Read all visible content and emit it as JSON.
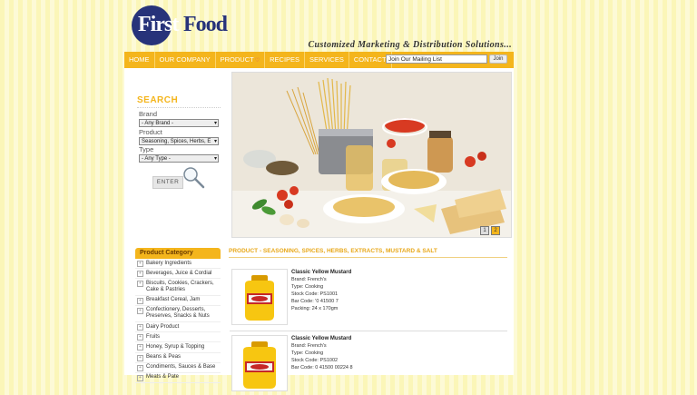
{
  "header": {
    "logo_first": "First",
    "logo_food": "Food",
    "tagline": "Customized Marketing & Distribution Solutions..."
  },
  "nav": {
    "items": [
      "HOME",
      "OUR COMPANY",
      "PRODUCT",
      "RECIPES",
      "SERVICES",
      "CONTACT"
    ],
    "mailing_placeholder": "Join Our Mailing List",
    "join_label": "Join"
  },
  "search": {
    "title": "SEARCH",
    "brand_label": "Brand",
    "brand_value": "- Any Brand -",
    "product_label": "Product",
    "product_value": "Seasoning, Spices, Herbs, E",
    "type_label": "Type",
    "type_value": "- Any Type -",
    "enter_label": "ENTER"
  },
  "categories": {
    "title": "Product Category",
    "items": [
      "Bakery Ingredients",
      "Beverages, Juice & Cordial",
      "Biscuits, Cookies, Crackers, Cake & Pastries",
      "Breakfast Cereal, Jam",
      "Confectionery, Desserts, Preserves, Snacks & Nuts",
      "Dairy Product",
      "Fruits",
      "Honey, Syrup & Topping",
      "Beans & Peas",
      "Condiments, Sauces & Base",
      "Meats & Pate"
    ]
  },
  "hero": {
    "pages": [
      "1",
      "2"
    ],
    "colors": {
      "pasta": "#e9c36a",
      "tomato": "#d83a22",
      "basil": "#3f8a2f"
    }
  },
  "products": {
    "section_title": "PRODUCT - SEASONING, SPICES, HERBS, EXTRACTS, MUSTARD & SALT",
    "items": [
      {
        "name": "Classic Yellow Mustard",
        "brand": "Brand: French's",
        "type": "Type: Cooking",
        "stock": "Stock Code: PS1001",
        "barcode": "Bar Code: '0 41500 7",
        "packing": "Packing: 24 x 170gm"
      },
      {
        "name": "Classic Yellow Mustard",
        "brand": "Brand: French's",
        "type": "Type: Cooking",
        "stock": "Stock Code: PS1002",
        "barcode": "Bar Code: 0 41500 00224 8",
        "packing": ""
      }
    ]
  },
  "colors": {
    "accent": "#f4b51c",
    "brand_blue": "#27337a",
    "text": "#333333"
  }
}
